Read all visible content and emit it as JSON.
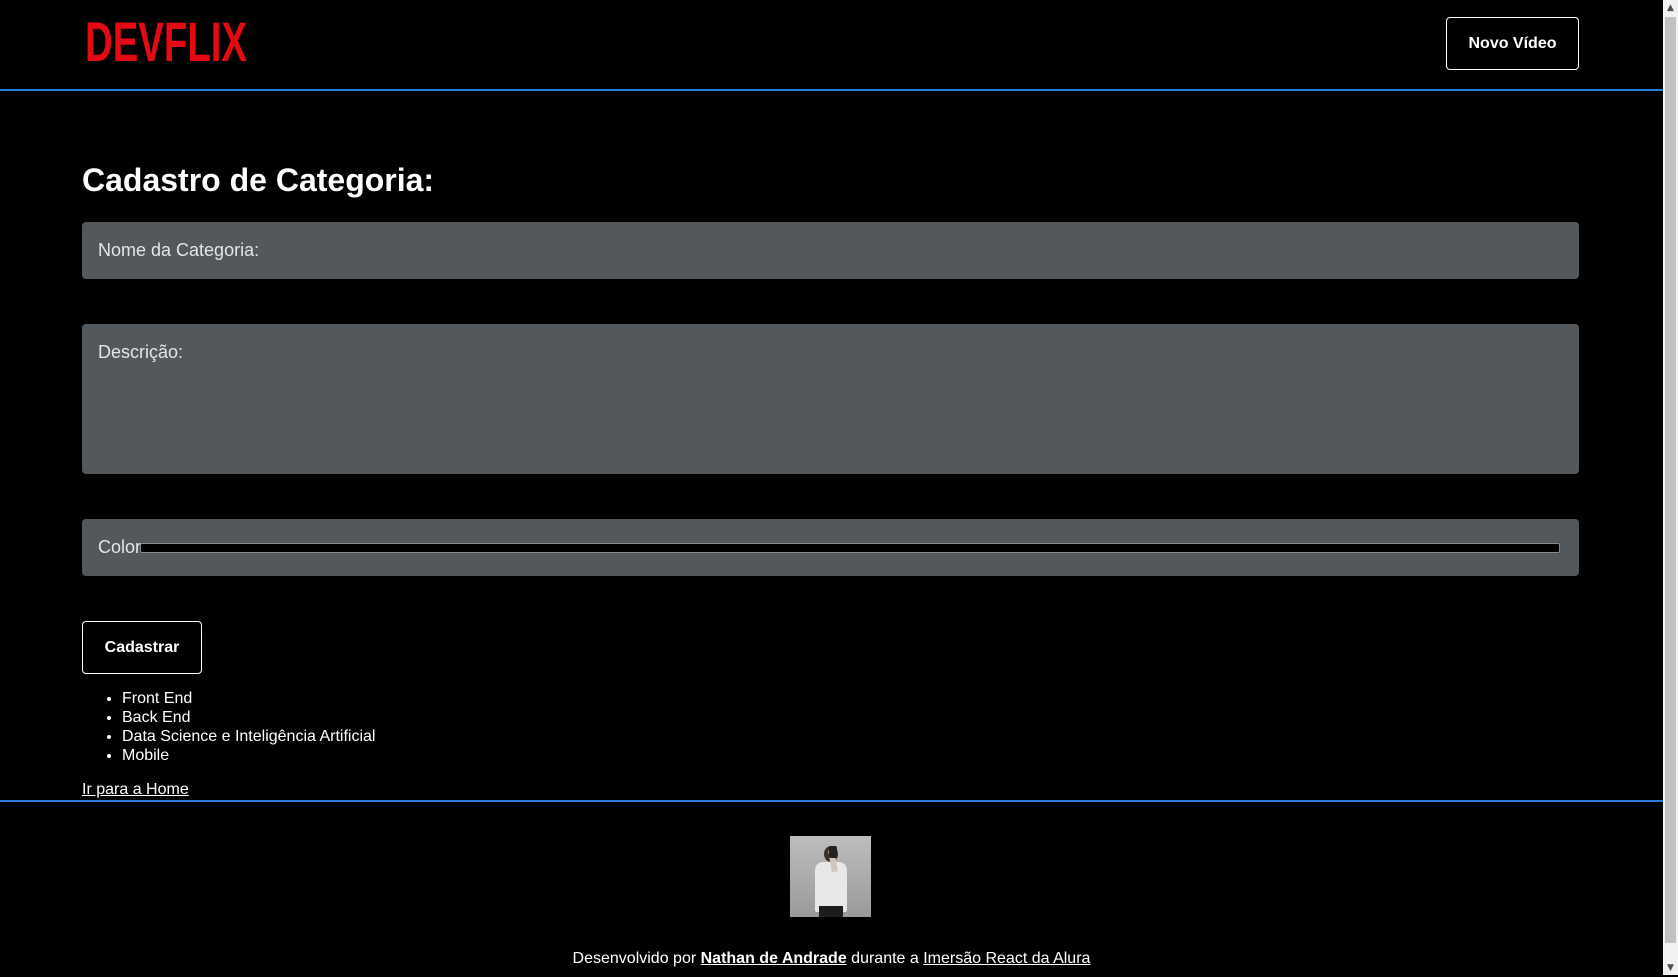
{
  "header": {
    "logo_text": "DEVFLIX",
    "new_video_label": "Novo Vídeo"
  },
  "form": {
    "title": "Cadastro de Categoria:",
    "name_label": "Nome da Categoria:",
    "name_value": "",
    "description_label": "Descrição:",
    "description_value": "",
    "color_label": "Color:",
    "color_value": "#000000",
    "submit_label": "Cadastrar"
  },
  "categories": [
    "Front End",
    "Back End",
    "Data Science e Inteligência Artificial",
    "Mobile"
  ],
  "home_link_label": "Ir para a Home",
  "footer": {
    "prefix": "Desenvolvido por",
    "author": "Nathan de Andrade",
    "middle": "durante a",
    "course": "Imersão React da Alura"
  },
  "colors": {
    "brand_red": "#e50914",
    "accent_blue": "#2a7ae4",
    "field_bg": "#53585d",
    "page_bg": "#000000"
  },
  "icons": {
    "scroll_up": "▲",
    "scroll_down": "▼"
  }
}
